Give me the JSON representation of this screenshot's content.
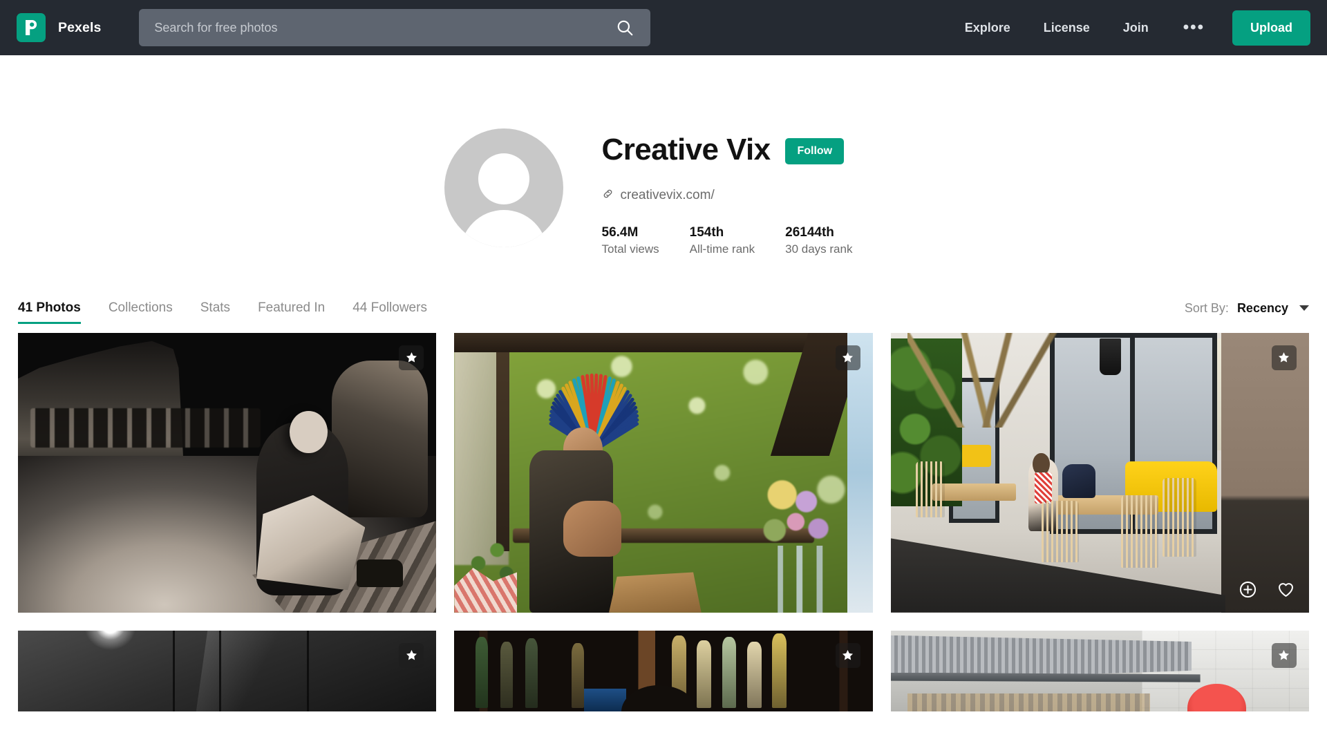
{
  "header": {
    "logo_icon": "pexels-logo-icon",
    "brand_name": "Pexels",
    "search": {
      "placeholder": "Search for free photos",
      "value": "",
      "icon": "search-icon"
    },
    "nav_links": [
      {
        "label": "Explore"
      },
      {
        "label": "License"
      },
      {
        "label": "Join"
      }
    ],
    "more_label": "•••",
    "upload_label": "Upload",
    "background_color": "#252a32",
    "accent_color": "#05a081",
    "search_bg_color": "#5e6570"
  },
  "profile": {
    "avatar_icon": "default-avatar-icon",
    "display_name": "Creative Vix",
    "follow_label": "Follow",
    "link_icon": "link-icon",
    "website": "creativevix.com/",
    "stats": [
      {
        "value": "56.4M",
        "label": "Total views"
      },
      {
        "value": "154th",
        "label": "All-time rank"
      },
      {
        "value": "26144th",
        "label": "30 days rank"
      }
    ]
  },
  "tabs": [
    {
      "label": "41 Photos",
      "active": true
    },
    {
      "label": "Collections",
      "active": false
    },
    {
      "label": "Stats",
      "active": false
    },
    {
      "label": "Featured In",
      "active": false
    },
    {
      "label": "44 Followers",
      "active": false
    }
  ],
  "sort": {
    "label": "Sort By:",
    "value": "Recency",
    "caret_icon": "chevron-down-icon"
  },
  "photos": [
    {
      "alt": "Two women sitting on a bench at night, black and white",
      "badge_icon": "star-icon",
      "badge": true,
      "hover_actions": []
    },
    {
      "alt": "Man wearing colorful feather headdress working at an outdoor stall",
      "badge_icon": "star-icon",
      "badge": true,
      "hover_actions": []
    },
    {
      "alt": "Woman sitting at a table in a cafe interior with large windows",
      "badge_icon": "star-icon",
      "badge": true,
      "hover_actions": [
        {
          "icon": "plus-circle-icon"
        },
        {
          "icon": "heart-icon"
        }
      ]
    },
    {
      "alt": "Dark industrial ceiling with hanging lamp, black and white",
      "badge_icon": "star-icon",
      "badge": true,
      "hover_actions": []
    },
    {
      "alt": "Bartender in front of shelves stocked with bottles",
      "badge_icon": "star-icon",
      "badge": true,
      "hover_actions": []
    },
    {
      "alt": "Commercial kitchen extraction hood with tiled walls",
      "badge_icon": "star-icon",
      "badge": true,
      "hover_actions": []
    }
  ]
}
